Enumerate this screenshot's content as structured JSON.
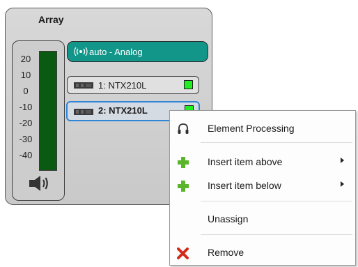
{
  "panel": {
    "title": "Array",
    "scale_labels": [
      "20",
      "10",
      "0",
      "-10",
      "-20",
      "-30",
      "-40"
    ],
    "meter_level_fraction": 0.0,
    "meter_icon": "speaker-volume-icon",
    "source": {
      "label": "auto - Analog",
      "icon": "signal-broadcast-icon",
      "color": "#12968a"
    },
    "elements": [
      {
        "label": "1: NTX210L",
        "status_color": "#22ee22",
        "selected": false
      },
      {
        "label": "2: NTX210L",
        "status_color": "#22ee22",
        "selected": true
      }
    ]
  },
  "context_menu": {
    "items": [
      {
        "label": "Element Processing",
        "icon": "headphones-icon"
      },
      {
        "label": "Insert item above",
        "icon": "plus-green-icon",
        "submenu": true
      },
      {
        "label": "Insert item below",
        "icon": "plus-green-icon",
        "submenu": true
      },
      {
        "label": "Unassign",
        "icon": ""
      },
      {
        "label": "Remove",
        "icon": "red-x-icon"
      }
    ]
  },
  "colors": {
    "selection_border": "#2f86d6",
    "meter_green": "#0b5a12",
    "plus_green": "#5ab52a",
    "remove_red": "#d42a1a"
  }
}
